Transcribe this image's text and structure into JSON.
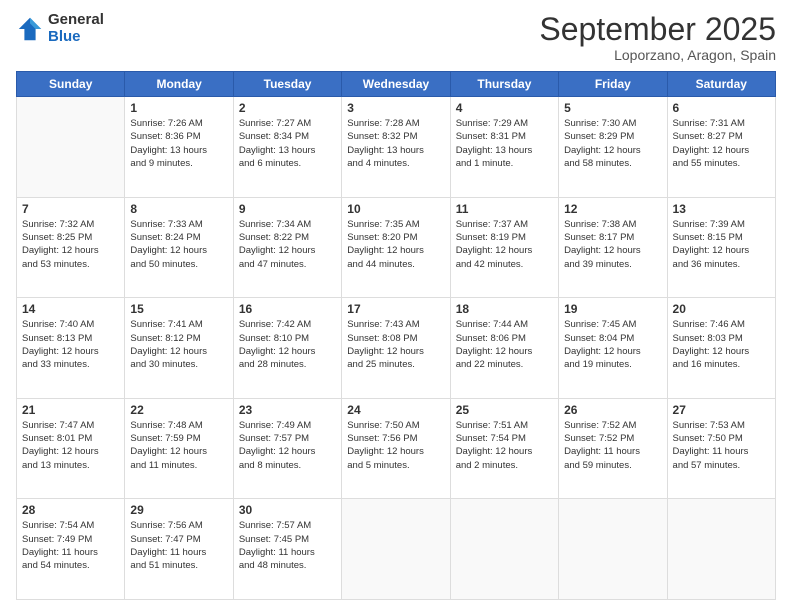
{
  "logo": {
    "text_general": "General",
    "text_blue": "Blue"
  },
  "header": {
    "month": "September 2025",
    "location": "Loporzano, Aragon, Spain"
  },
  "weekdays": [
    "Sunday",
    "Monday",
    "Tuesday",
    "Wednesday",
    "Thursday",
    "Friday",
    "Saturday"
  ],
  "weeks": [
    [
      {
        "day": "",
        "info": ""
      },
      {
        "day": "1",
        "info": "Sunrise: 7:26 AM\nSunset: 8:36 PM\nDaylight: 13 hours\nand 9 minutes."
      },
      {
        "day": "2",
        "info": "Sunrise: 7:27 AM\nSunset: 8:34 PM\nDaylight: 13 hours\nand 6 minutes."
      },
      {
        "day": "3",
        "info": "Sunrise: 7:28 AM\nSunset: 8:32 PM\nDaylight: 13 hours\nand 4 minutes."
      },
      {
        "day": "4",
        "info": "Sunrise: 7:29 AM\nSunset: 8:31 PM\nDaylight: 13 hours\nand 1 minute."
      },
      {
        "day": "5",
        "info": "Sunrise: 7:30 AM\nSunset: 8:29 PM\nDaylight: 12 hours\nand 58 minutes."
      },
      {
        "day": "6",
        "info": "Sunrise: 7:31 AM\nSunset: 8:27 PM\nDaylight: 12 hours\nand 55 minutes."
      }
    ],
    [
      {
        "day": "7",
        "info": "Sunrise: 7:32 AM\nSunset: 8:25 PM\nDaylight: 12 hours\nand 53 minutes."
      },
      {
        "day": "8",
        "info": "Sunrise: 7:33 AM\nSunset: 8:24 PM\nDaylight: 12 hours\nand 50 minutes."
      },
      {
        "day": "9",
        "info": "Sunrise: 7:34 AM\nSunset: 8:22 PM\nDaylight: 12 hours\nand 47 minutes."
      },
      {
        "day": "10",
        "info": "Sunrise: 7:35 AM\nSunset: 8:20 PM\nDaylight: 12 hours\nand 44 minutes."
      },
      {
        "day": "11",
        "info": "Sunrise: 7:37 AM\nSunset: 8:19 PM\nDaylight: 12 hours\nand 42 minutes."
      },
      {
        "day": "12",
        "info": "Sunrise: 7:38 AM\nSunset: 8:17 PM\nDaylight: 12 hours\nand 39 minutes."
      },
      {
        "day": "13",
        "info": "Sunrise: 7:39 AM\nSunset: 8:15 PM\nDaylight: 12 hours\nand 36 minutes."
      }
    ],
    [
      {
        "day": "14",
        "info": "Sunrise: 7:40 AM\nSunset: 8:13 PM\nDaylight: 12 hours\nand 33 minutes."
      },
      {
        "day": "15",
        "info": "Sunrise: 7:41 AM\nSunset: 8:12 PM\nDaylight: 12 hours\nand 30 minutes."
      },
      {
        "day": "16",
        "info": "Sunrise: 7:42 AM\nSunset: 8:10 PM\nDaylight: 12 hours\nand 28 minutes."
      },
      {
        "day": "17",
        "info": "Sunrise: 7:43 AM\nSunset: 8:08 PM\nDaylight: 12 hours\nand 25 minutes."
      },
      {
        "day": "18",
        "info": "Sunrise: 7:44 AM\nSunset: 8:06 PM\nDaylight: 12 hours\nand 22 minutes."
      },
      {
        "day": "19",
        "info": "Sunrise: 7:45 AM\nSunset: 8:04 PM\nDaylight: 12 hours\nand 19 minutes."
      },
      {
        "day": "20",
        "info": "Sunrise: 7:46 AM\nSunset: 8:03 PM\nDaylight: 12 hours\nand 16 minutes."
      }
    ],
    [
      {
        "day": "21",
        "info": "Sunrise: 7:47 AM\nSunset: 8:01 PM\nDaylight: 12 hours\nand 13 minutes."
      },
      {
        "day": "22",
        "info": "Sunrise: 7:48 AM\nSunset: 7:59 PM\nDaylight: 12 hours\nand 11 minutes."
      },
      {
        "day": "23",
        "info": "Sunrise: 7:49 AM\nSunset: 7:57 PM\nDaylight: 12 hours\nand 8 minutes."
      },
      {
        "day": "24",
        "info": "Sunrise: 7:50 AM\nSunset: 7:56 PM\nDaylight: 12 hours\nand 5 minutes."
      },
      {
        "day": "25",
        "info": "Sunrise: 7:51 AM\nSunset: 7:54 PM\nDaylight: 12 hours\nand 2 minutes."
      },
      {
        "day": "26",
        "info": "Sunrise: 7:52 AM\nSunset: 7:52 PM\nDaylight: 11 hours\nand 59 minutes."
      },
      {
        "day": "27",
        "info": "Sunrise: 7:53 AM\nSunset: 7:50 PM\nDaylight: 11 hours\nand 57 minutes."
      }
    ],
    [
      {
        "day": "28",
        "info": "Sunrise: 7:54 AM\nSunset: 7:49 PM\nDaylight: 11 hours\nand 54 minutes."
      },
      {
        "day": "29",
        "info": "Sunrise: 7:56 AM\nSunset: 7:47 PM\nDaylight: 11 hours\nand 51 minutes."
      },
      {
        "day": "30",
        "info": "Sunrise: 7:57 AM\nSunset: 7:45 PM\nDaylight: 11 hours\nand 48 minutes."
      },
      {
        "day": "",
        "info": ""
      },
      {
        "day": "",
        "info": ""
      },
      {
        "day": "",
        "info": ""
      },
      {
        "day": "",
        "info": ""
      }
    ]
  ]
}
